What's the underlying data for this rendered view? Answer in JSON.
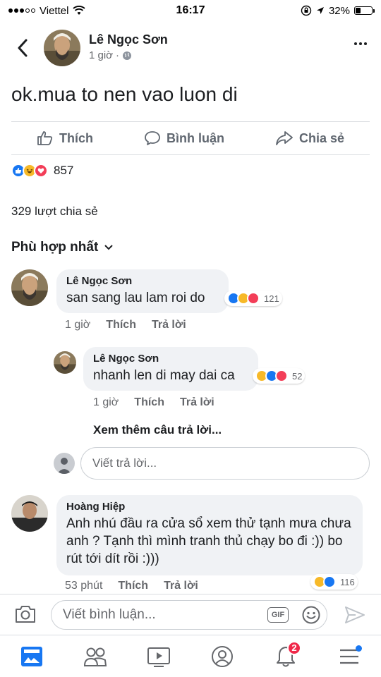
{
  "status": {
    "carrier": "Viettel",
    "time": "16:17",
    "battery": "32%",
    "battery_level": 0.32
  },
  "post": {
    "author": "Lê Ngọc Sơn",
    "time": "1 giờ",
    "text": "ok.mua to nen vao luon di",
    "actions": {
      "like": "Thích",
      "comment": "Bình luận",
      "share": "Chia sẻ"
    },
    "reactions_count": "857",
    "shares": "329 lượt chia sẻ"
  },
  "sort_label": "Phù hợp nhất",
  "comments": [
    {
      "name": "Lê Ngọc Sơn",
      "text": "san sang lau lam roi do",
      "time": "1 giờ",
      "like": "Thích",
      "reply": "Trả lời",
      "reactions": "121"
    },
    {
      "name": "Lê Ngọc Sơn",
      "text": "nhanh len di may dai ca",
      "time": "1 giờ",
      "like": "Thích",
      "reply": "Trả lời",
      "reactions": "52"
    },
    {
      "name": "Hoàng Hiệp",
      "text": "Anh nhú đầu ra cửa sổ xem thử tạnh mưa chưa anh ? Tạnh thì mình tranh thủ chạy bo đi :)) bo rút tới dít rồi :)))",
      "time": "53 phút",
      "like": "Thích",
      "reply": "Trả lời",
      "reactions": "116"
    }
  ],
  "see_more_replies": "Xem thêm câu trả lời...",
  "reply_placeholder": "Viết trả lời...",
  "composer": {
    "placeholder": "Viết bình luận...",
    "gif": "GIF"
  },
  "tabs": {
    "notifications_badge": "2"
  },
  "colors": {
    "accent": "#1877f2",
    "like": "#1877f2",
    "haha": "#f7b928",
    "love": "#f33e58",
    "badge": "#f02849"
  }
}
